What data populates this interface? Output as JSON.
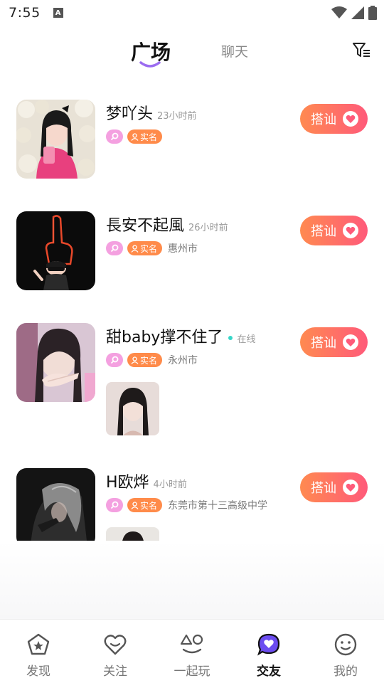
{
  "status_bar": {
    "time": "7:55",
    "notification_glyph": "A"
  },
  "header": {
    "tab_active": "广场",
    "tab_other": "聊天",
    "accent_color": "#9b6cf0"
  },
  "feed": [
    {
      "name": "梦吖头",
      "time_ago": "23小时前",
      "badge_real": "实名",
      "city": "",
      "online": "",
      "action": "搭讪",
      "has_photo": false
    },
    {
      "name": "長安不起風",
      "time_ago": "26小时前",
      "badge_real": "实名",
      "city": "惠州市",
      "online": "",
      "action": "搭讪",
      "has_photo": false
    },
    {
      "name": "甜baby撑不住了",
      "time_ago": "",
      "badge_real": "实名",
      "city": "永州市",
      "online": "在线",
      "action": "搭讪",
      "has_photo": true
    },
    {
      "name": "H欧烨",
      "time_ago": "4小时前",
      "badge_real": "实名",
      "city": "东莞市第十三高级中学",
      "online": "",
      "action": "搭讪",
      "has_photo": true
    }
  ],
  "bottom_nav": [
    {
      "label": "发现",
      "icon": "pentagon-star-icon",
      "active": false
    },
    {
      "label": "关注",
      "icon": "heart-outline-icon",
      "active": false
    },
    {
      "label": "一起玩",
      "icon": "shapes-icon",
      "active": false
    },
    {
      "label": "交友",
      "icon": "chat-heart-icon",
      "active": true
    },
    {
      "label": "我的",
      "icon": "smiley-icon",
      "active": false
    }
  ],
  "colors": {
    "button_gradient_start": "#ff8a50",
    "button_gradient_end": "#ff5a7a",
    "badge_pink": "#f4a0e0",
    "badge_orange": "#ff8b4a",
    "online_dot": "#37d6c8"
  }
}
